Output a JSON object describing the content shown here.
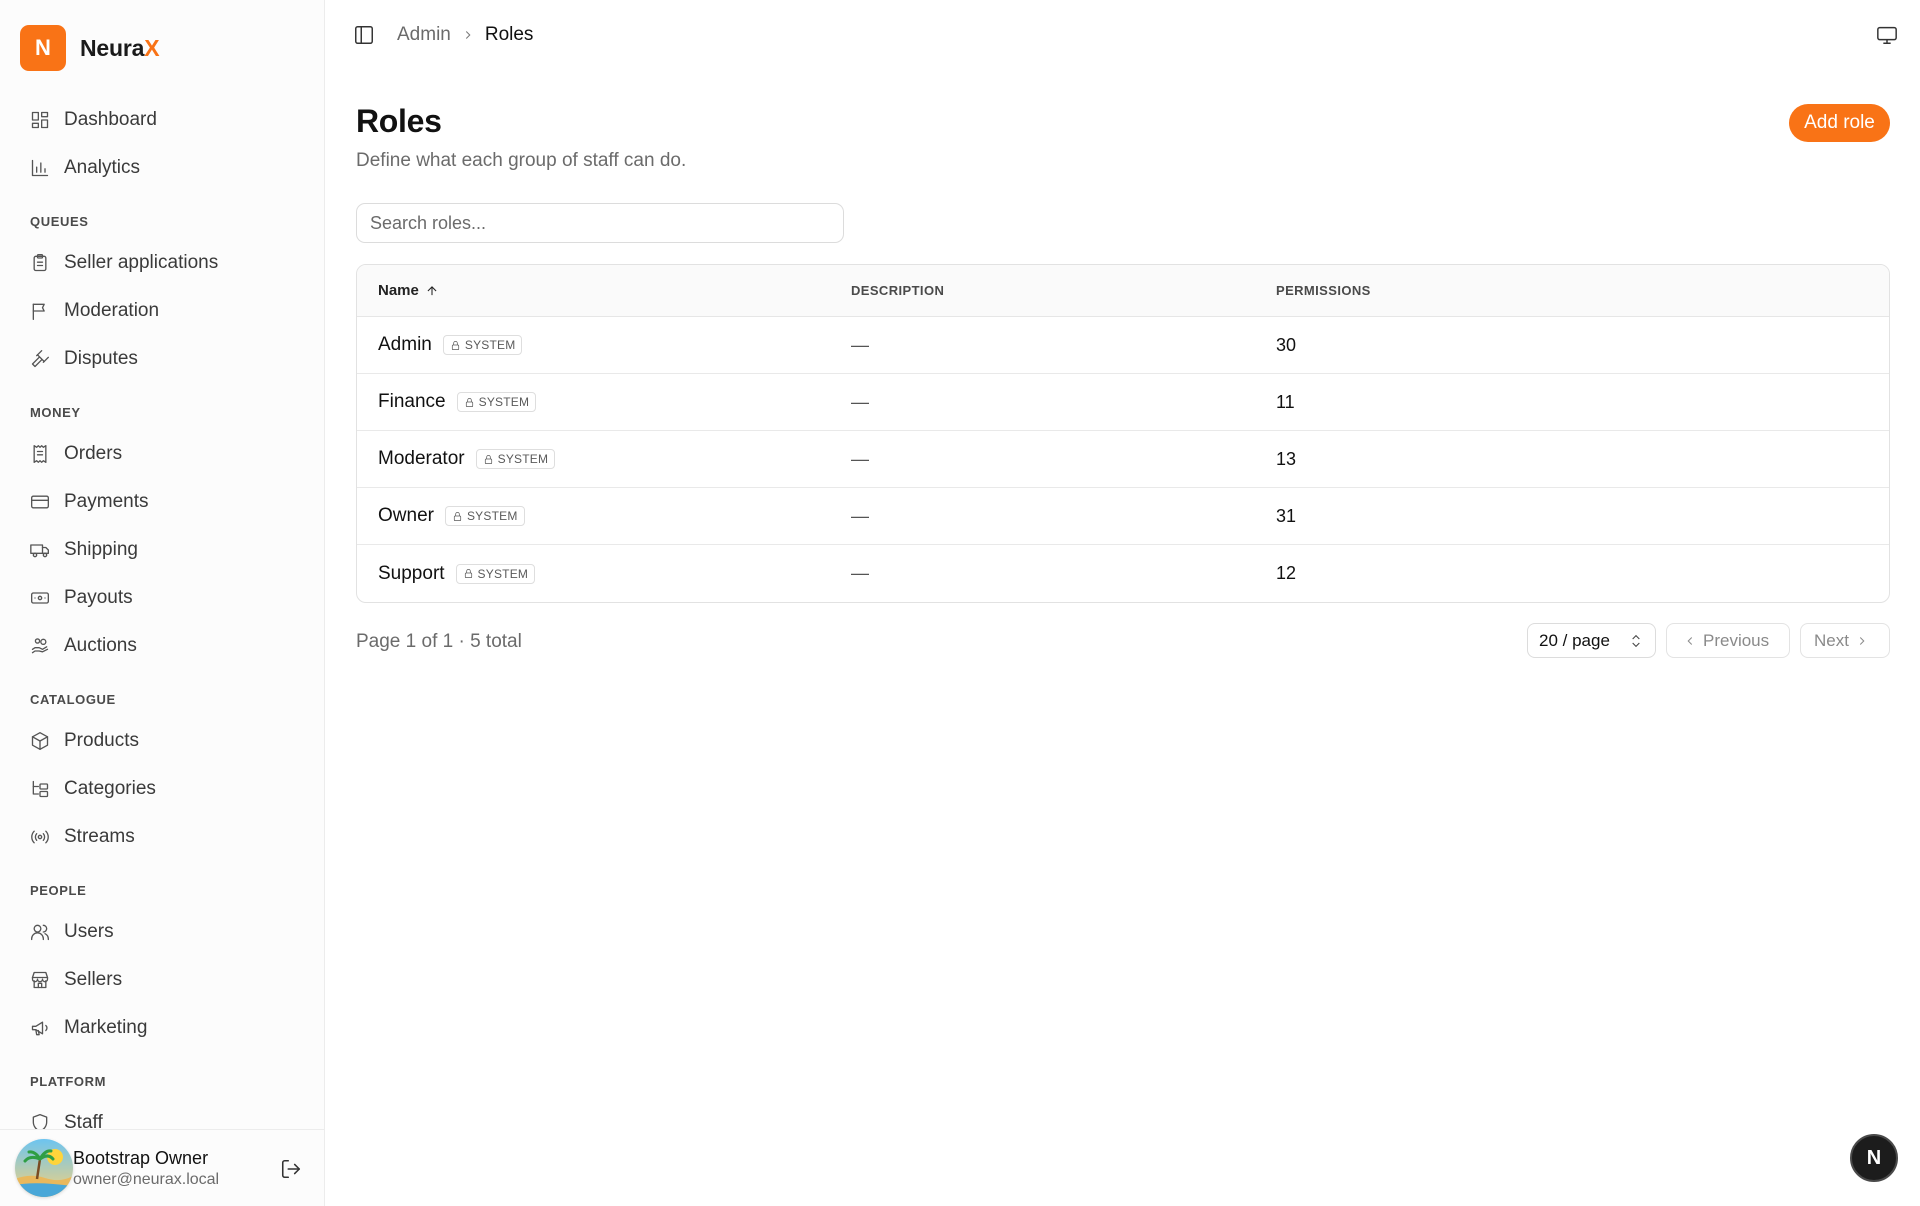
{
  "brand": {
    "logo_letter": "N",
    "name_main": "Neura",
    "name_accent": "X"
  },
  "colors": {
    "accent": "#f97316",
    "fab": "#1c1c1c"
  },
  "sidebar": {
    "top_items": [
      {
        "label": "Dashboard",
        "icon": "dashboard-icon"
      },
      {
        "label": "Analytics",
        "icon": "analytics-icon"
      }
    ],
    "sections": {
      "queues": "QUEUES",
      "money": "MONEY",
      "catalogue": "CATALOGUE",
      "people": "PEOPLE",
      "platform": "PLATFORM"
    },
    "queues_items": [
      {
        "label": "Seller applications",
        "icon": "clipboard-icon"
      },
      {
        "label": "Moderation",
        "icon": "flag-icon"
      },
      {
        "label": "Disputes",
        "icon": "gavel-icon"
      }
    ],
    "money_items": [
      {
        "label": "Orders",
        "icon": "receipt-icon"
      },
      {
        "label": "Payments",
        "icon": "credit-card-icon"
      },
      {
        "label": "Shipping",
        "icon": "truck-icon"
      },
      {
        "label": "Payouts",
        "icon": "banknote-icon"
      },
      {
        "label": "Auctions",
        "icon": "hand-coins-icon"
      }
    ],
    "catalogue_items": [
      {
        "label": "Products",
        "icon": "package-icon"
      },
      {
        "label": "Categories",
        "icon": "folder-tree-icon"
      },
      {
        "label": "Streams",
        "icon": "radio-icon"
      }
    ],
    "people_items": [
      {
        "label": "Users",
        "icon": "users-icon"
      },
      {
        "label": "Sellers",
        "icon": "store-icon"
      },
      {
        "label": "Marketing",
        "icon": "megaphone-icon"
      }
    ],
    "platform_items": [
      {
        "label": "Staff",
        "icon": "shield-icon"
      }
    ]
  },
  "user": {
    "name": "Bootstrap Owner",
    "email": "owner@neurax.local"
  },
  "breadcrumb": {
    "parent": "Admin",
    "current": "Roles"
  },
  "page": {
    "title": "Roles",
    "subtitle": "Define what each group of staff can do.",
    "add_button": "Add role",
    "search_placeholder": "Search roles..."
  },
  "table": {
    "columns": {
      "name": "Name",
      "description": "DESCRIPTION",
      "permissions": "PERMISSIONS"
    },
    "badge_label": "SYSTEM",
    "rows": [
      {
        "name": "Admin",
        "description": "—",
        "permissions": "30"
      },
      {
        "name": "Finance",
        "description": "—",
        "permissions": "11"
      },
      {
        "name": "Moderator",
        "description": "—",
        "permissions": "13"
      },
      {
        "name": "Owner",
        "description": "—",
        "permissions": "31"
      },
      {
        "name": "Support",
        "description": "—",
        "permissions": "12"
      }
    ]
  },
  "pagination": {
    "info": "Page 1 of 1 · 5 total",
    "per_page": "20 / page",
    "previous": "Previous",
    "next": "Next"
  },
  "fab_letter": "N"
}
